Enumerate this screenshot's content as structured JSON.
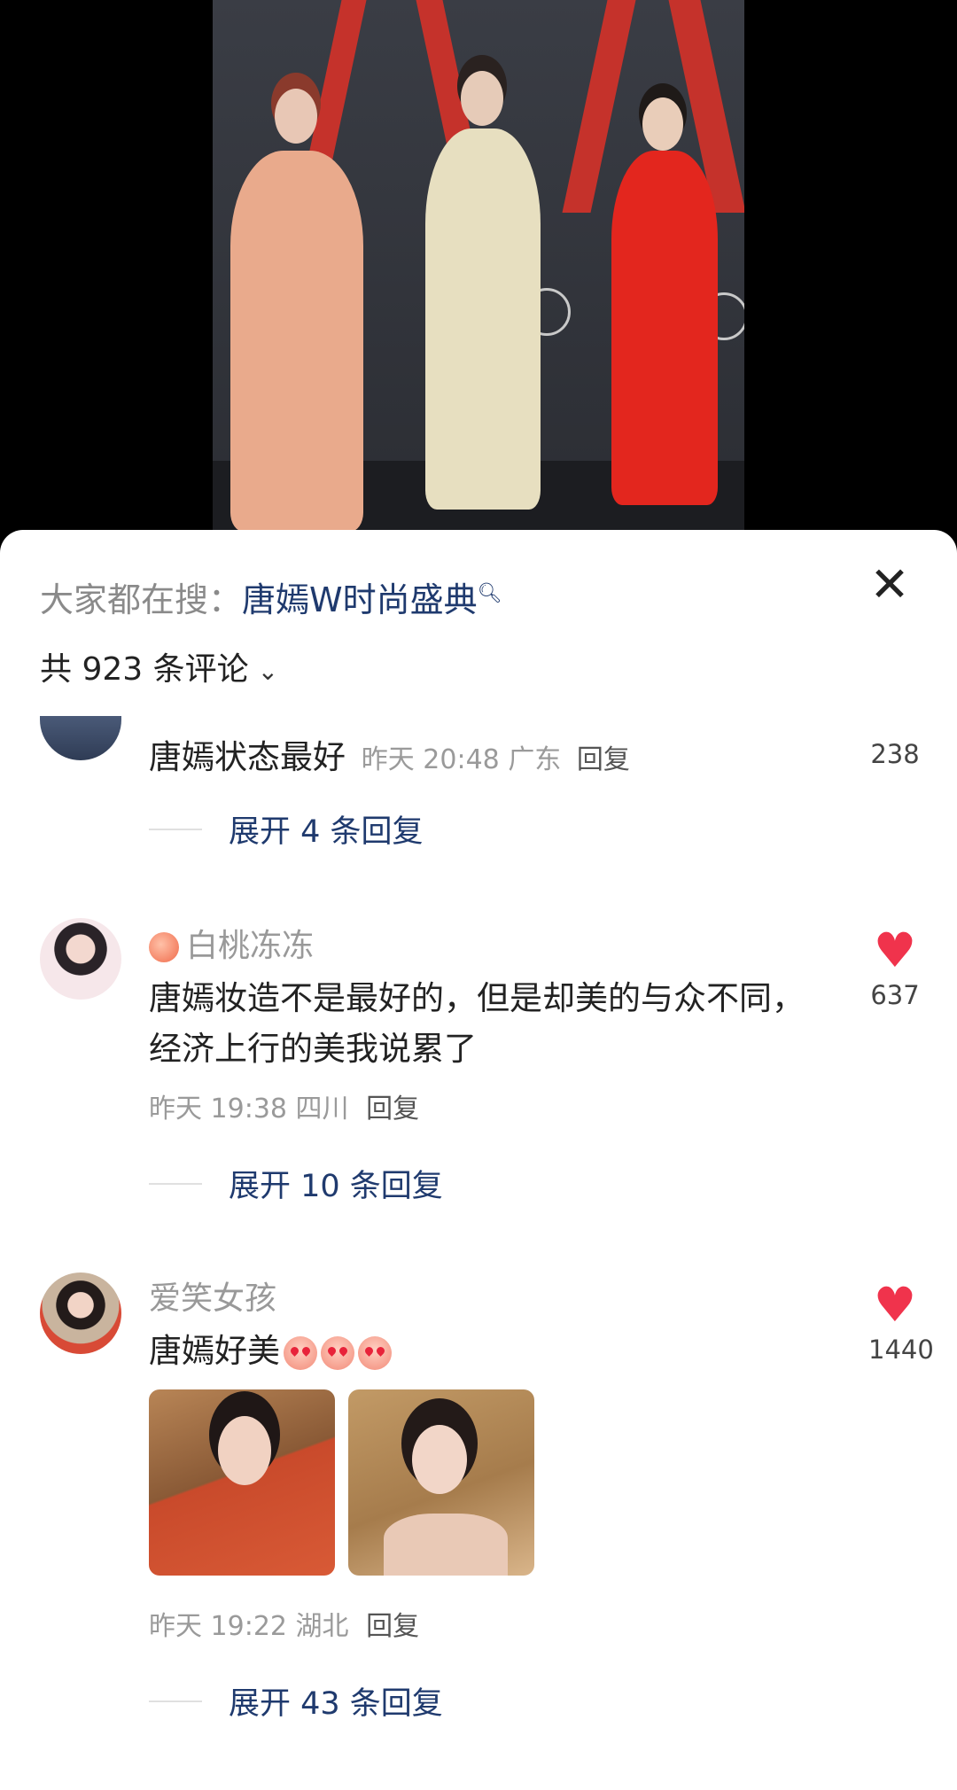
{
  "search_bar": {
    "prefix": "大家都在搜：",
    "query": "唐嫣W时尚盛典",
    "search_icon": "magnifier-icon"
  },
  "close_icon": "close-icon",
  "comment_count_label": "共 923 条评论",
  "comments": [
    {
      "text": "唐嫣状态最好",
      "time": "昨天 20:48",
      "location": "广东",
      "reply_label": "回复",
      "likes": "238",
      "expand_label": "展开 4 条回复"
    },
    {
      "username": "白桃冻冻",
      "text": "唐嫣妆造不是最好的，但是却美的与众不同，经济上行的美我说累了",
      "time": "昨天 19:38",
      "location": "四川",
      "reply_label": "回复",
      "likes": "637",
      "expand_label": "展开 10 条回复"
    },
    {
      "username": "爱笑女孩",
      "text": "唐嫣好美",
      "time": "昨天 19:22",
      "location": "湖北",
      "reply_label": "回复",
      "likes": "1440",
      "expand_label": "展开 43 条回复"
    }
  ],
  "colors": {
    "link_blue": "#1f3a6e",
    "like_red": "#f0334c",
    "sheet_bg": "#ffffff"
  }
}
